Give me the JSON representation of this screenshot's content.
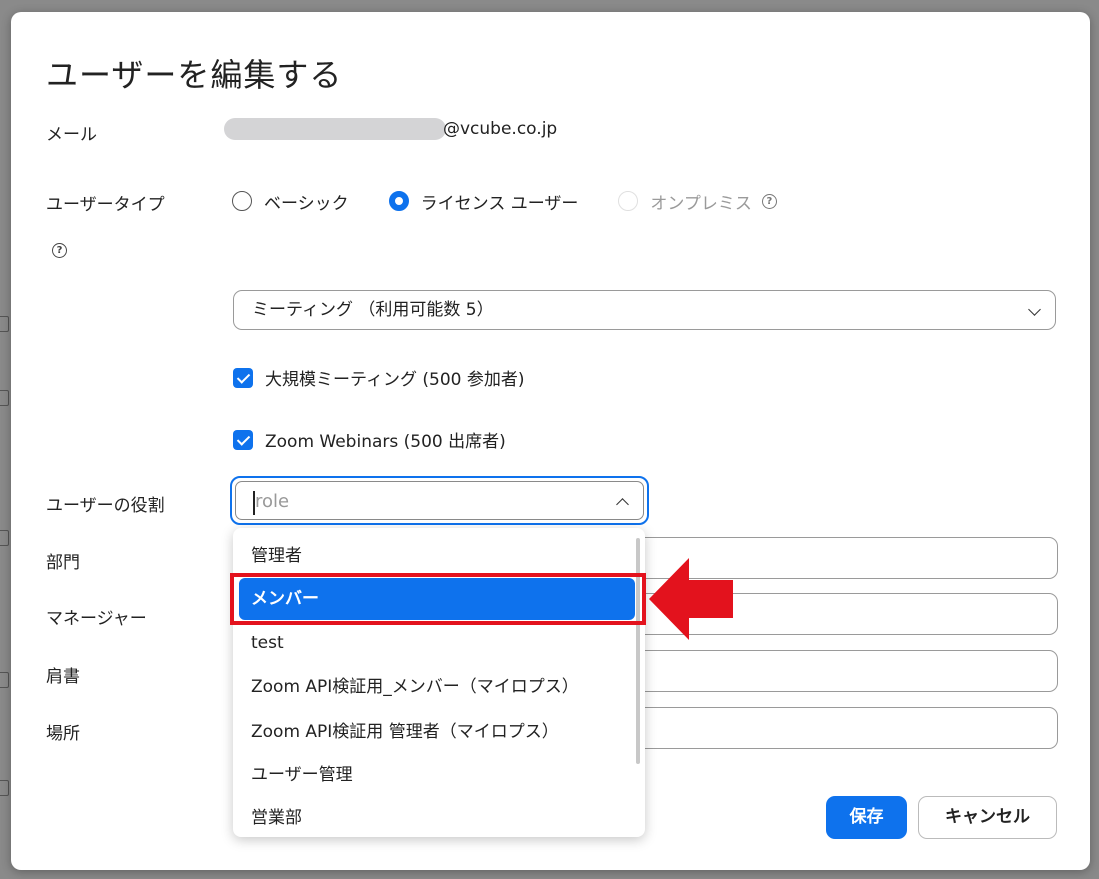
{
  "dialog": {
    "title": "ユーザーを編集する",
    "email": {
      "label": "メール",
      "suffix": "@vcube.co.jp"
    },
    "user_type": {
      "label": "ユーザータイプ",
      "options": [
        {
          "label": "ベーシック",
          "checked": false,
          "disabled": false
        },
        {
          "label": "ライセンス ユーザー",
          "checked": true,
          "disabled": false
        },
        {
          "label": "オンプレミス",
          "checked": false,
          "disabled": true
        }
      ]
    },
    "license_select": {
      "value": "ミーティング （利用可能数 5）"
    },
    "checkboxes": [
      {
        "label": "大規模ミーティング (500 参加者)",
        "checked": true
      },
      {
        "label": "Zoom Webinars (500 出席者)",
        "checked": true
      }
    ],
    "role": {
      "label": "ユーザーの役割",
      "placeholder": "role",
      "options": [
        "管理者",
        "メンバー",
        "test",
        "Zoom API検証用_メンバー（マイロプス）",
        "Zoom API検証用  管理者（マイロプス）",
        "ユーザー管理",
        "営業部"
      ],
      "selected": "メンバー"
    },
    "fields": {
      "department": "部門",
      "manager": "マネージャー",
      "job_title": "肩書",
      "location": "場所"
    },
    "buttons": {
      "save": "保存",
      "cancel": "キャンセル"
    }
  },
  "colors": {
    "accent": "#0e72ed",
    "highlight": "#e3121d"
  },
  "icons": {
    "help": "help-circle-icon",
    "chevron_down": "chevron-down-icon",
    "chevron_up": "chevron-up-icon",
    "arrow": "red-left-arrow-icon"
  }
}
